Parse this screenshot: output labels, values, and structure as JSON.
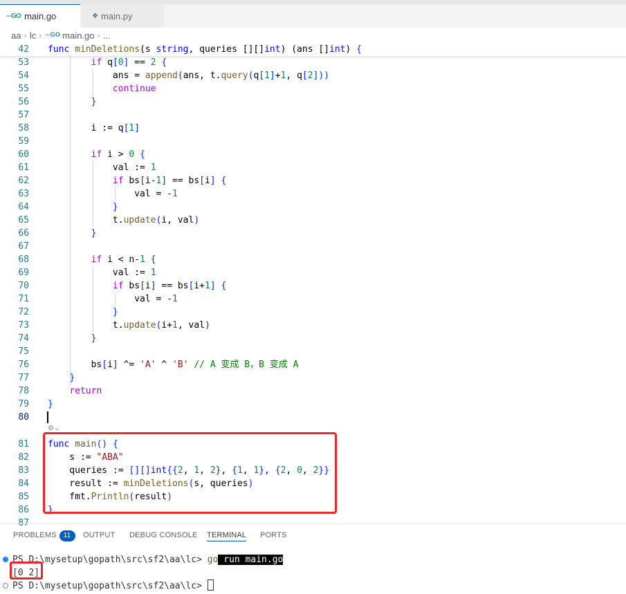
{
  "tabs": [
    {
      "label": "main.go",
      "icon": "go-icon",
      "active": true
    },
    {
      "label": "main.py",
      "icon": "python-icon",
      "active": false
    }
  ],
  "breadcrumb": [
    "aa",
    "lc",
    "main.go",
    "..."
  ],
  "code": {
    "sticky_line": {
      "num": "42",
      "text": "func minDeletions(s string, queries [][]int) (ans []int) {"
    },
    "lines": [
      {
        "num": "53",
        "text": "        if q[0] == 2 {"
      },
      {
        "num": "54",
        "text": "            ans = append(ans, t.query(q[1]+1, q[2]))"
      },
      {
        "num": "55",
        "text": "            continue"
      },
      {
        "num": "56",
        "text": "        }"
      },
      {
        "num": "57",
        "text": ""
      },
      {
        "num": "58",
        "text": "        i := q[1]"
      },
      {
        "num": "59",
        "text": ""
      },
      {
        "num": "60",
        "text": "        if i > 0 {"
      },
      {
        "num": "61",
        "text": "            val := 1"
      },
      {
        "num": "62",
        "text": "            if bs[i-1] == bs[i] {"
      },
      {
        "num": "63",
        "text": "                val = -1"
      },
      {
        "num": "64",
        "text": "            }"
      },
      {
        "num": "65",
        "text": "            t.update(i, val)"
      },
      {
        "num": "66",
        "text": "        }"
      },
      {
        "num": "67",
        "text": ""
      },
      {
        "num": "68",
        "text": "        if i < n-1 {"
      },
      {
        "num": "69",
        "text": "            val := 1"
      },
      {
        "num": "70",
        "text": "            if bs[i] == bs[i+1] {"
      },
      {
        "num": "71",
        "text": "                val = -1"
      },
      {
        "num": "72",
        "text": "            }"
      },
      {
        "num": "73",
        "text": "            t.update(i+1, val)"
      },
      {
        "num": "74",
        "text": "        }"
      },
      {
        "num": "75",
        "text": ""
      },
      {
        "num": "76",
        "text": "        bs[i] ^= 'A' ^ 'B' // A 变成 B，B 变成 A"
      },
      {
        "num": "77",
        "text": "    }"
      },
      {
        "num": "78",
        "text": "    return"
      },
      {
        "num": "79",
        "text": "}"
      },
      {
        "num": "80",
        "text": ""
      },
      {
        "num": "81",
        "text": "func main() {"
      },
      {
        "num": "82",
        "text": "    s := \"ABA\""
      },
      {
        "num": "83",
        "text": "    queries := [][]int{{2, 1, 2}, {1, 1}, {2, 0, 2}}"
      },
      {
        "num": "84",
        "text": "    result := minDeletions(s, queries)"
      },
      {
        "num": "85",
        "text": "    fmt.Println(result)"
      },
      {
        "num": "86",
        "text": "}"
      },
      {
        "num": "87",
        "text": ""
      }
    ]
  },
  "panel": {
    "tabs": [
      {
        "label": "PROBLEMS",
        "badge": "11"
      },
      {
        "label": "OUTPUT"
      },
      {
        "label": "DEBUG CONSOLE"
      },
      {
        "label": "TERMINAL",
        "active": true
      },
      {
        "label": "PORTS"
      }
    ],
    "terminal": {
      "prompt1": "PS D:\\mysetup\\gopath\\src\\sf2\\aa\\lc> ",
      "cmd_part1": "go",
      "cmd_part2": " run main.go",
      "output": "[0 2]",
      "prompt2": "PS D:\\mysetup\\gopath\\src\\sf2\\aa\\lc> "
    }
  },
  "colors": {
    "keyword": "#af00db",
    "type": "#0000ff",
    "function": "#795e26",
    "number": "#098658",
    "string": "#a31515",
    "comment": "#008000",
    "highlight_box": "#e8282b",
    "accent": "#005fb8"
  }
}
